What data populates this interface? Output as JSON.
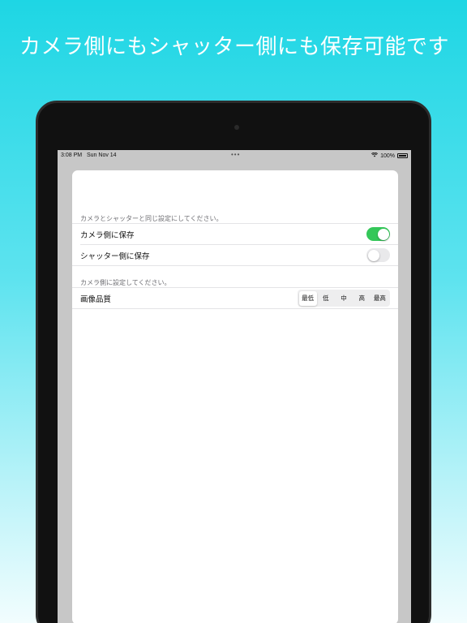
{
  "promo": {
    "headline": "カメラ側にもシャッター側にも保存可能です"
  },
  "status_bar": {
    "time": "3:08 PM",
    "date": "Sun Nov 14",
    "multitask_dots": "•••",
    "battery_text": "100%"
  },
  "settings": {
    "group1_header": "カメラとシャッターと同じ設定にしてください。",
    "camera_save": {
      "label": "カメラ側に保存",
      "enabled": true
    },
    "shutter_save": {
      "label": "シャッター側に保存",
      "enabled": false
    },
    "group2_header": "カメラ側に設定してください。",
    "image_quality": {
      "label": "画像品質",
      "options": [
        "最低",
        "低",
        "中",
        "高",
        "最高"
      ],
      "selected": "最低"
    }
  },
  "colors": {
    "toggle_on": "#34c759",
    "toggle_off": "#e9e9eb",
    "background_top": "#1ed6e4",
    "background_bottom": "#f2fdfe"
  }
}
